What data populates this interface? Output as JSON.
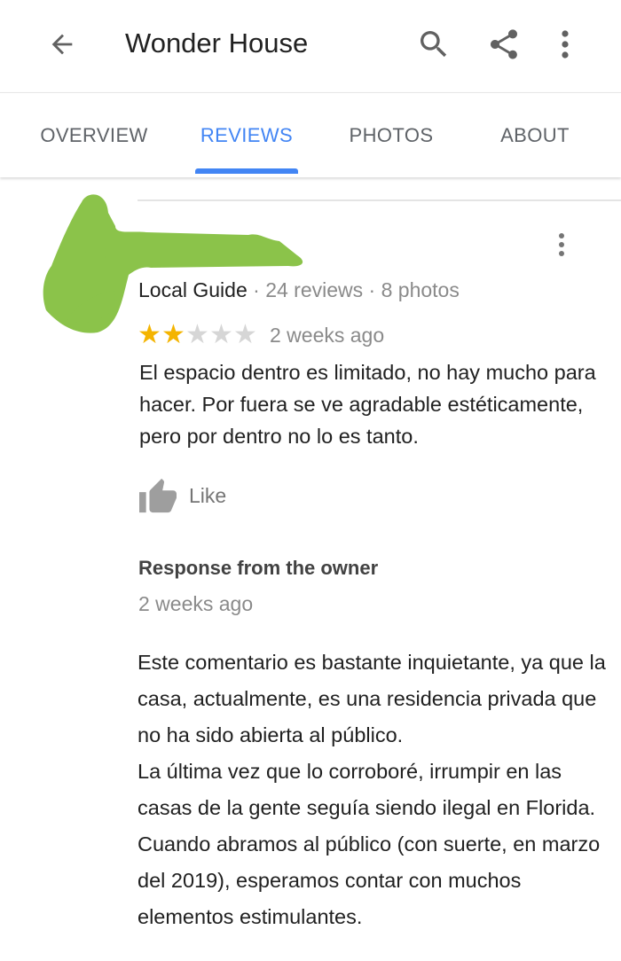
{
  "appbar": {
    "title": "Wonder House",
    "icons": [
      "arrow-back-icon",
      "search-icon",
      "share-icon",
      "more-vert-icon"
    ]
  },
  "tabs": [
    {
      "label": "OVERVIEW",
      "active": false
    },
    {
      "label": "REVIEWS",
      "active": true
    },
    {
      "label": "PHOTOS",
      "active": false
    },
    {
      "label": "ABOUT",
      "active": false
    }
  ],
  "review": {
    "reviewer_type": "Local Guide",
    "reviews_count": "24 reviews",
    "photos_count": "8 photos",
    "rating": 2,
    "rating_max": 5,
    "time": "2 weeks ago",
    "text": "El espacio dentro es limitado, no hay mucho para hacer. Por fuera se ve agradable estéticamente, pero por dentro no lo es tanto.",
    "like_label": "Like"
  },
  "owner_response": {
    "heading": "Response from the owner",
    "time": "2 weeks ago",
    "text": "Este comentario es bastante inquietante, ya que la casa, actualmente, es una residencia privada que no ha sido abierta al público.\nLa última vez que lo corroboré, irrumpir en las casas de la gente seguía siendo ilegal en Florida. Cuando abramos al público (con suerte, en marzo del 2019), esperamos contar con muchos elementos estimulantes."
  },
  "colors": {
    "accent": "#4285f4",
    "star": "#f4b400",
    "redaction": "#8bc34a"
  }
}
